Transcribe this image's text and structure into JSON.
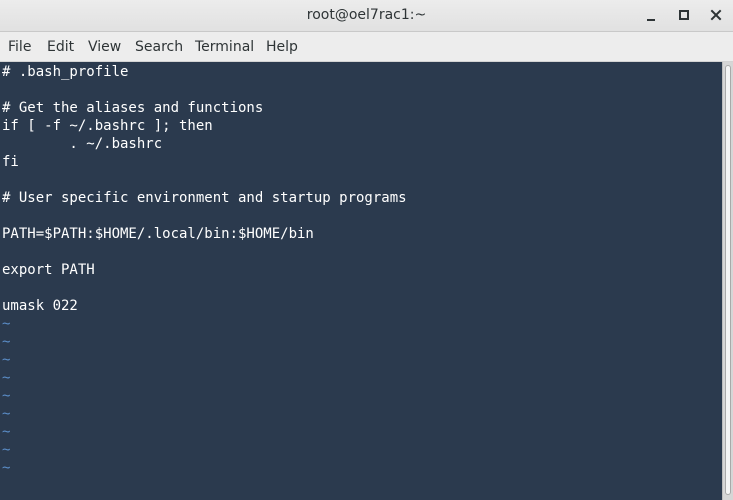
{
  "window": {
    "title": "root@oel7rac1:~"
  },
  "menu": [
    "File",
    "Edit",
    "View",
    "Search",
    "Terminal",
    "Help"
  ],
  "terminal": {
    "lines": [
      "# .bash_profile",
      "",
      "# Get the aliases and functions",
      "if [ -f ~/.bashrc ]; then",
      "        . ~/.bashrc",
      "fi",
      "",
      "# User specific environment and startup programs",
      "",
      "PATH=$PATH:$HOME/.local/bin:$HOME/bin",
      "",
      "export PATH",
      "",
      "umask 022",
      "~",
      "~",
      "~",
      "~",
      "~",
      "~",
      "~",
      "~",
      "~"
    ]
  },
  "icons": {
    "minimize": "minimize-icon",
    "maximize": "maximize-icon",
    "close": "close-icon"
  },
  "colors": {
    "terminal_bg": "#2b3a4e",
    "text": "#ffffff",
    "tilde": "#5b8ec9"
  }
}
